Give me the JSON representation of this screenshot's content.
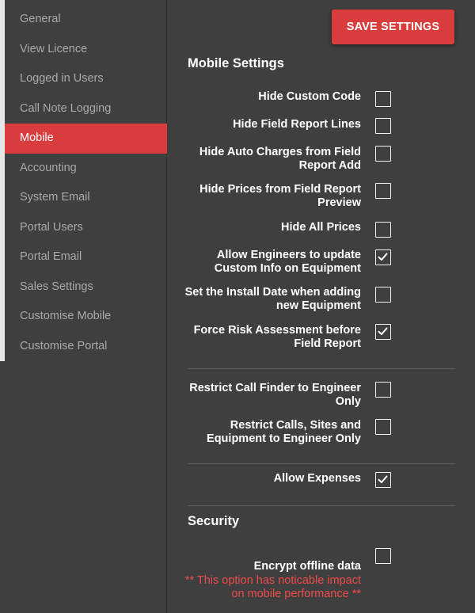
{
  "sidebar": {
    "items": [
      {
        "label": "General",
        "active": false
      },
      {
        "label": "View Licence",
        "active": false
      },
      {
        "label": "Logged in Users",
        "active": false
      },
      {
        "label": "Call Note Logging",
        "active": false
      },
      {
        "label": "Mobile",
        "active": true
      },
      {
        "label": "Accounting",
        "active": false
      },
      {
        "label": "System Email",
        "active": false
      },
      {
        "label": "Portal Users",
        "active": false
      },
      {
        "label": "Portal Email",
        "active": false
      },
      {
        "label": "Sales Settings",
        "active": false
      },
      {
        "label": "Customise Mobile",
        "active": false
      },
      {
        "label": "Customise Portal",
        "active": false
      }
    ]
  },
  "toolbar": {
    "save_label": "SAVE SETTINGS"
  },
  "mobile_section": {
    "title": "Mobile Settings",
    "settings": [
      {
        "label": "Hide Custom Code",
        "checked": false
      },
      {
        "label": "Hide Field Report Lines",
        "checked": false
      },
      {
        "label": "Hide Auto Charges from Field Report Add",
        "checked": false
      },
      {
        "label": "Hide Prices from Field Report Preview",
        "checked": false
      },
      {
        "label": "Hide All Prices",
        "checked": false
      },
      {
        "label": "Allow Engineers to update Custom Info on Equipment",
        "checked": true
      },
      {
        "label": "Set the Install Date when adding new Equipment",
        "checked": false
      },
      {
        "label": "Force Risk Assessment before Field Report",
        "checked": true
      }
    ],
    "restrict_settings": [
      {
        "label": "Restrict Call Finder to Engineer Only",
        "checked": false
      },
      {
        "label": "Restrict Calls, Sites and Equipment to Engineer Only",
        "checked": false
      }
    ],
    "expense_settings": [
      {
        "label": "Allow Expenses",
        "checked": true
      }
    ]
  },
  "security_section": {
    "title": "Security",
    "encrypt": {
      "label": "Encrypt offline data",
      "checked": false,
      "warning": "** This option has noticable impact on mobile performance **"
    }
  },
  "colors": {
    "accent": "#d93c3c",
    "background": "#3f3f3f",
    "warning": "#ee4b4b"
  }
}
